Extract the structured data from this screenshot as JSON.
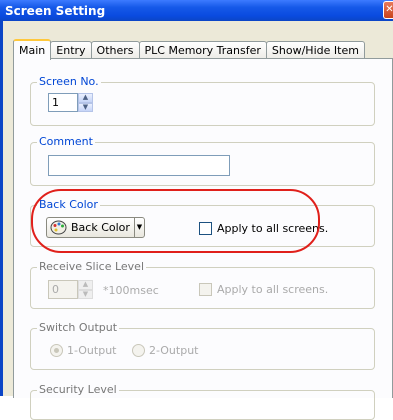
{
  "window": {
    "title": "Screen Setting",
    "close_glyph": "✕",
    "close_icon": "close-icon"
  },
  "tabs": [
    {
      "label": "Main",
      "active": true
    },
    {
      "label": "Entry"
    },
    {
      "label": "Others"
    },
    {
      "label": "PLC Memory Transfer"
    },
    {
      "label": "Show/Hide Item"
    }
  ],
  "screen_no": {
    "label": "Screen No.",
    "value": "1"
  },
  "comment": {
    "label": "Comment",
    "value": ""
  },
  "back_color": {
    "label": "Back Color",
    "button_label": "Back Color",
    "icon": "palette-icon",
    "dropdown_glyph": "▼",
    "apply_all_label": "Apply to all screens.",
    "apply_all_checked": false
  },
  "receive_slice": {
    "label": "Receive Slice Level",
    "value": "0",
    "unit": "*100msec",
    "apply_all_label": "Apply to all screens.",
    "enabled": false
  },
  "switch_output": {
    "label": "Switch Output",
    "options": [
      "1-Output",
      "2-Output"
    ],
    "selected": "1-Output",
    "enabled": false
  },
  "security_level": {
    "label": "Security Level"
  },
  "colors": {
    "highlight": "#e0201b",
    "title_bar": "#0a4be0",
    "group_label": "#0046d5"
  }
}
